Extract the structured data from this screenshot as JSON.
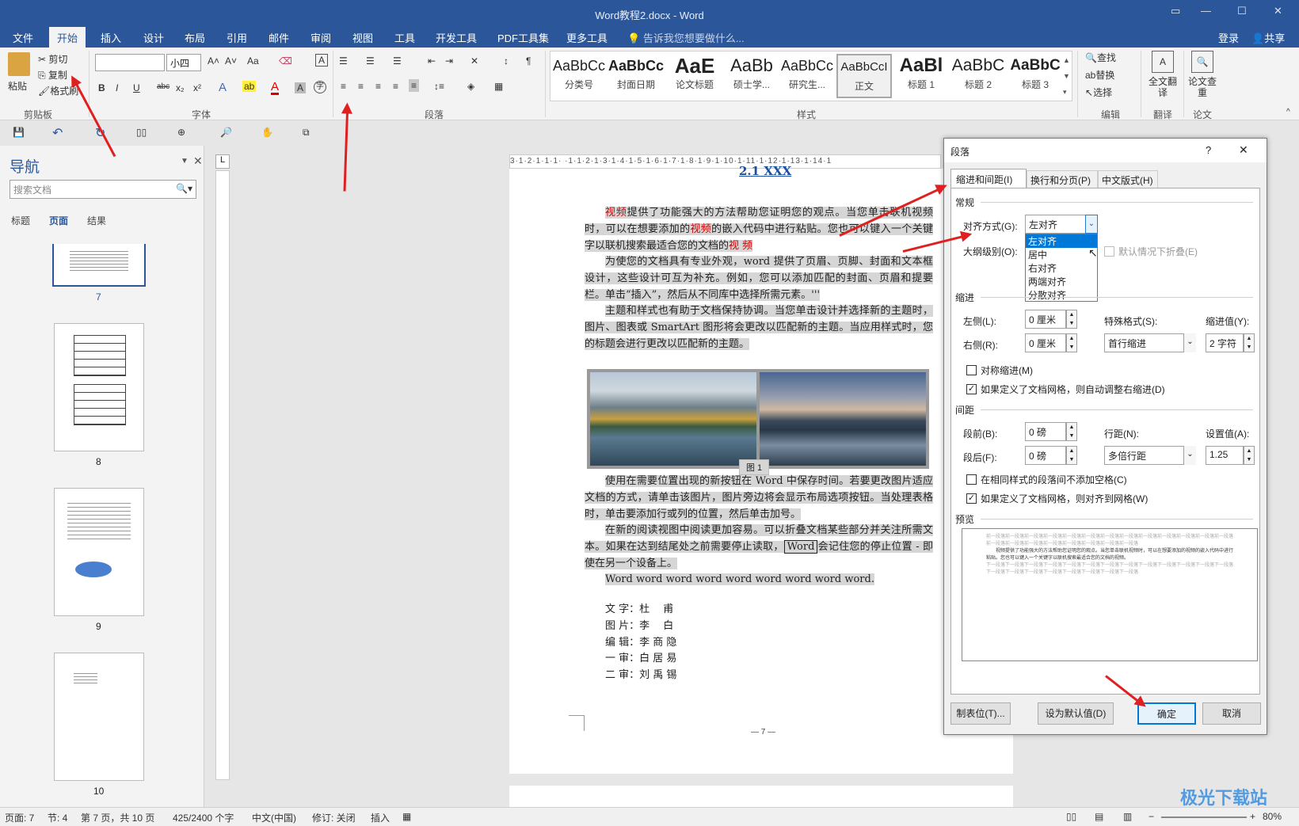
{
  "window": {
    "title": "Word教程2.docx - Word",
    "login": "登录",
    "share": "共享"
  },
  "tabs": [
    "文件",
    "开始",
    "插入",
    "设计",
    "布局",
    "引用",
    "邮件",
    "审阅",
    "视图",
    "工具",
    "开发工具",
    "PDF工具集",
    "更多工具"
  ],
  "tell_me": "告诉我您想要做什么...",
  "ribbon": {
    "clipboard": {
      "paste": "粘贴",
      "cut": "剪切",
      "copy": "复制",
      "format_painter": "格式刷",
      "label": "剪贴板"
    },
    "font": {
      "size": "小四",
      "label": "字体",
      "case": "Aa"
    },
    "paragraph": {
      "label": "段落"
    },
    "styles": {
      "items": [
        {
          "preview": "AaBbCc",
          "name": "分类号"
        },
        {
          "preview": "AaBbCc",
          "name": "封面日期"
        },
        {
          "preview": "AaE",
          "name": "论文标题"
        },
        {
          "preview": "AaBb",
          "name": "硕士学..."
        },
        {
          "preview": "AaBbCc",
          "name": "研究生..."
        },
        {
          "preview": "AaBbCcI",
          "name": "正文"
        },
        {
          "preview": "AaBl",
          "name": "标题 1"
        },
        {
          "preview": "AaBbC",
          "name": "标题 2"
        },
        {
          "preview": "AaBbC",
          "name": "标题 3"
        }
      ],
      "label": "样式"
    },
    "editing": {
      "find": "查找",
      "replace": "替换",
      "select": "选择",
      "label": "编辑"
    },
    "translate": {
      "btn": "全文翻译",
      "label": "翻译"
    },
    "paper": {
      "btn": "论文查重",
      "label": "论文"
    }
  },
  "nav": {
    "title": "导航",
    "search_placeholder": "搜索文档",
    "tabs": [
      "标题",
      "页面",
      "结果"
    ],
    "pages": [
      "7",
      "8",
      "9",
      "10"
    ]
  },
  "ruler": {
    "marks": "3·1·2·1·1·1· ·1·1·2·1·3·1·4·1·5·1·6·1·7·1·8·1·9·1·10·1·11·1·12·1·13·1·14·1"
  },
  "document": {
    "heading": "2.1 XXX",
    "p1": [
      "视频",
      "提供了功能强大的方法帮助您证明您的观点。当您单击联机视频时，可以在想要添加的",
      "视频",
      "的嵌入代码中进行粘贴。您也可以键入一个关键字以联机搜索最适合您的文档的",
      "视 频"
    ],
    "p2": "为使您的文档具有专业外观，word 提供了页眉、页脚、封面和文本框设计，这些设计可互为补充。例如，您可以添加匹配的封面、页眉和提要栏。单击“插入”，然后从不同库中选择所需元素。'''",
    "p3": "主题和样式也有助于文档保持协调。当您单击设计并选择新的主题时，图片、图表或 SmartArt 图形将会更改以匹配新的主题。当应用样式时，您的标题会进行更改以匹配新的主题。",
    "caption": "图 1",
    "p4": "使用在需要位置出现的新按钮在 Word 中保存时间。若要更改图片适应文档的方式，请单击该图片，图片旁边将会显示布局选项按钮。当处理表格时，单击要添加行或列的位置，然后单击加号。",
    "p5a": "在新的阅读视图中阅读更加容易。可以折叠文档某些部分并关注所需文本。如果在达到结尾处之前需要停止读取，",
    "p5word": "Word",
    "p5b": "会记住您的停止位置 - 即使在另一个设备上。",
    "p6": "Word word word word word word word word word.",
    "credits": [
      [
        "文 字：",
        "杜　 甫"
      ],
      [
        "图 片：",
        "李　 白"
      ],
      [
        "编 辑：",
        "李 商 隐"
      ],
      [
        "一 审：",
        "白 居 易"
      ],
      [
        "二 审：",
        "刘 禹 锡"
      ]
    ],
    "page_no": "— 7 —"
  },
  "dialog": {
    "title": "段落",
    "help": "?",
    "close": "✕",
    "tabs": [
      "缩进和间距(I)",
      "换行和分页(P)",
      "中文版式(H)"
    ],
    "general": "常规",
    "alignment_label": "对齐方式(G):",
    "alignment_value": "左对齐",
    "alignment_options": [
      "左对齐",
      "居中",
      "右对齐",
      "两端对齐",
      "分散对齐"
    ],
    "outline_label": "大纲级别(O):",
    "collapse_label": "默认情况下折叠(E)",
    "indent": "缩进",
    "left_label": "左侧(L):",
    "left_value": "0 厘米",
    "right_label": "右侧(R):",
    "right_value": "0 厘米",
    "special_label": "特殊格式(S):",
    "special_value": "首行缩进",
    "by_label": "缩进值(Y):",
    "by_value": "2 字符",
    "mirror_label": "对称缩进(M)",
    "auto_right_label": "如果定义了文档网格，则自动调整右缩进(D)",
    "spacing": "间距",
    "before_label": "段前(B):",
    "before_value": "0 磅",
    "after_label": "段后(F):",
    "after_value": "0 磅",
    "line_label": "行距(N):",
    "line_value": "多倍行距",
    "at_label": "设置值(A):",
    "at_value": "1.25",
    "no_space_label": "在相同样式的段落间不添加空格(C)",
    "snap_label": "如果定义了文档网格，则对齐到网格(W)",
    "preview": "预览",
    "preview_prev": "前一段落前一段落前一段落前一段落前一段落前一段落前一段落前一段落前一段落前一段落前一段落前一段落前一段落前一段落前一段落前一段落前一段落前一段落前一段落前一段落前一段落",
    "preview_text": "视频提供了功能强大的方法帮助您证明您的观点。当您单击联机视频时，可以在想要添加的视频的嵌入代码中进行粘贴。您也可以键入一个关键字以联机搜索最适合您的文档的视频。",
    "preview_next": "下一段落下一段落下一段落下一段落下一段落下一段落下一段落下一段落下一段落下一段落下一段落下一段落下一段落下一段落下一段落下一段落下一段落下一段落下一段落下一段落下一段落",
    "tabs_btn": "制表位(T)...",
    "default_btn": "设为默认值(D)",
    "ok_btn": "确定",
    "cancel_btn": "取消"
  },
  "status": {
    "page": "页面: 7",
    "section": "节: 4",
    "pageof": "第 7 页，共 10 页",
    "words": "425/2400 个字",
    "lang": "中文(中国)",
    "track": "修订: 关闭",
    "insert": "插入",
    "zoom": "80%"
  },
  "watermark": "极光下载站"
}
